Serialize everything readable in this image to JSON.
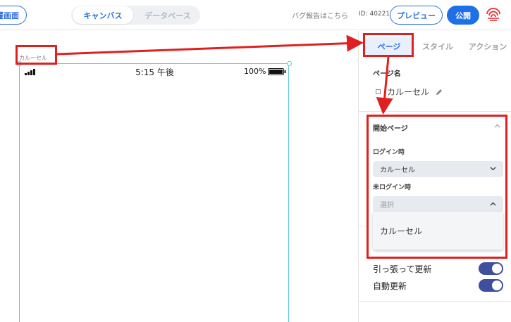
{
  "topbar": {
    "new_screen_label": "覆画面",
    "segments": {
      "canvas": "キャンバス",
      "database": "データベース"
    },
    "bug_report": "バグ報告はこちら",
    "id_text": "ID: 40221",
    "preview_label": "プレビュー",
    "publish_label": "公開"
  },
  "canvas": {
    "page_label": "カルーセル",
    "status_bar": {
      "time": "5:15 午後",
      "battery": "100%"
    }
  },
  "panel": {
    "tabs": {
      "page": "ページ",
      "style": "スタイル",
      "action": "アクション"
    },
    "page_name_title": "ページ名",
    "page_name_value": "カルーセル",
    "start_page_title": "開始ページ",
    "login_label": "ログイン時",
    "login_value": "カルーセル",
    "not_login_label": "未ログイン時",
    "not_login_placeholder": "選択",
    "dropdown_option": "カルーセル",
    "pull_refresh_label": "引っ張って更新",
    "auto_refresh_label": "自動更新"
  },
  "colors": {
    "accent": "#2f6fe0",
    "annotation": "#e02020",
    "toggle_on": "#3f4f9e",
    "frame": "#5ec8d8"
  },
  "toggles": {
    "pull_refresh_on": true,
    "auto_refresh_on": true
  }
}
